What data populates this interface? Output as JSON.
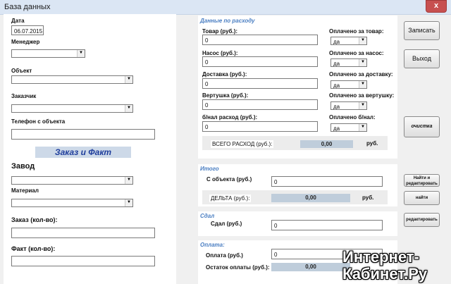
{
  "window": {
    "title": "База данных",
    "close": "x"
  },
  "left": {
    "date_label": "Дата",
    "date_value": "06.07.2015",
    "manager_label": "Менеджер",
    "manager_value": "",
    "object_label": "Объект",
    "object_value": "",
    "customer_label": "Заказчик",
    "customer_value": "",
    "phone_label": "Телефон с объекта",
    "phone_value": "",
    "banner": "Заказ и Факт",
    "plant_label": "Завод",
    "plant_value": "",
    "material_label": "Материал",
    "material_value": "",
    "order_label": "Заказ (кол-во):",
    "order_value": "",
    "fact_label": "Факт (кол-во):",
    "fact_value": ""
  },
  "expenses": {
    "section": "Данные по расходу",
    "rows": [
      {
        "label": "Товар (руб.):",
        "value": "0",
        "paid_label": "Оплачено за товар:",
        "paid_value": "да"
      },
      {
        "label": "Насос (руб.):",
        "value": "0",
        "paid_label": "Оплачено за насос:",
        "paid_value": "да"
      },
      {
        "label": "Доставка (руб.):",
        "value": "0",
        "paid_label": "Оплачено за доставку:",
        "paid_value": "да"
      },
      {
        "label": "Вертушка (руб.):",
        "value": "0",
        "paid_label": "Оплачено за вертушку:",
        "paid_value": "да"
      },
      {
        "label": "б/нал расход (руб.):",
        "value": "0",
        "paid_label": "Оплачено б/нал:",
        "paid_value": "да"
      }
    ],
    "total_label": "ВСЕГО РАСХОД (руб.):",
    "total_value": "0,00",
    "total_unit": "руб."
  },
  "total": {
    "section": "Итого",
    "from_object_label": "С объекта (руб.)",
    "from_object_value": "0",
    "delta_label": "ДЕЛЬТА (руб.):",
    "delta_value": "0,00",
    "delta_unit": "руб."
  },
  "handed": {
    "section": "Сдал",
    "label": "Сдал (руб.)",
    "value": "0"
  },
  "payment": {
    "section": "Оплата:",
    "label": "Оплата (руб.)",
    "value": "0",
    "remain_label": "Остаток оплаты (руб.):",
    "remain_value": "0,00"
  },
  "buttons": {
    "save": "Записать",
    "exit": "Выход",
    "clear": "очистка",
    "find_edit": "Найти и редактировать",
    "find": "найти",
    "edit": "редактировать"
  },
  "watermark": {
    "line1": "Интернет-",
    "line2": "Кабинет.Ру"
  }
}
